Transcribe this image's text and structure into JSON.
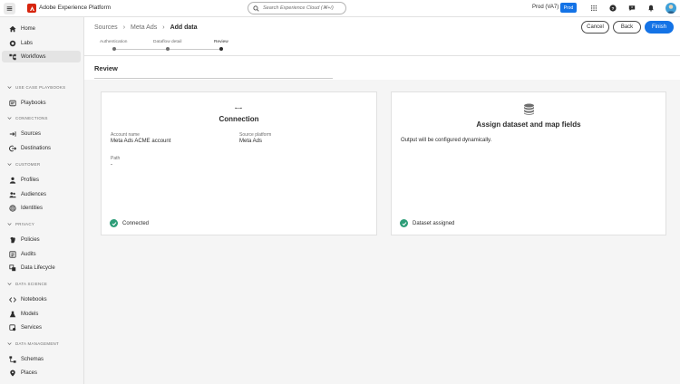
{
  "app": {
    "title": "Adobe Experience Platform"
  },
  "search": {
    "placeholder": "Search Experience Cloud (⌘+/)"
  },
  "header": {
    "org": "Prod (VA7)",
    "env_badge": "Prod"
  },
  "sidebar": {
    "items": [
      {
        "label": "Home",
        "icon": "home-icon"
      },
      {
        "label": "Labs",
        "icon": "labs-icon"
      },
      {
        "label": "Workflows",
        "icon": "workflows-icon",
        "active": true
      }
    ],
    "sections": [
      {
        "title": "USE CASE PLAYBOOKS",
        "items": [
          {
            "label": "Playbooks",
            "icon": "playbooks-icon"
          }
        ]
      },
      {
        "title": "CONNECTIONS",
        "items": [
          {
            "label": "Sources",
            "icon": "sources-icon"
          },
          {
            "label": "Destinations",
            "icon": "destinations-icon"
          }
        ]
      },
      {
        "title": "CUSTOMER",
        "items": [
          {
            "label": "Profiles",
            "icon": "profiles-icon"
          },
          {
            "label": "Audiences",
            "icon": "audiences-icon"
          },
          {
            "label": "Identities",
            "icon": "identities-icon"
          }
        ]
      },
      {
        "title": "PRIVACY",
        "items": [
          {
            "label": "Policies",
            "icon": "policies-icon"
          },
          {
            "label": "Audits",
            "icon": "audits-icon"
          },
          {
            "label": "Data Lifecycle",
            "icon": "data-lifecycle-icon"
          }
        ]
      },
      {
        "title": "DATA SCIENCE",
        "items": [
          {
            "label": "Notebooks",
            "icon": "notebooks-icon"
          },
          {
            "label": "Models",
            "icon": "models-icon"
          },
          {
            "label": "Services",
            "icon": "services-icon"
          }
        ]
      },
      {
        "title": "DATA MANAGEMENT",
        "items": [
          {
            "label": "Schemas",
            "icon": "schemas-icon"
          },
          {
            "label": "Places",
            "icon": "places-icon"
          }
        ]
      }
    ]
  },
  "breadcrumb": [
    "Sources",
    "Meta Ads",
    "Add data"
  ],
  "actions": {
    "cancel": "Cancel",
    "back": "Back",
    "finish": "Finish"
  },
  "steps": [
    {
      "label": "Authentication",
      "state": "done"
    },
    {
      "label": "Dataflow detail",
      "state": "done"
    },
    {
      "label": "Review",
      "state": "current"
    }
  ],
  "review": {
    "heading": "Review",
    "connection": {
      "title": "Connection",
      "account_name_label": "Account name",
      "account_name_value": "Meta Ads ACME account",
      "source_platform_label": "Source platform",
      "source_platform_value": "Meta Ads",
      "path_label": "Path",
      "path_value": "-",
      "status": "Connected"
    },
    "dataset": {
      "title": "Assign dataset and map fields",
      "description": "Output will be configured dynamically.",
      "status": "Dataset assigned"
    }
  },
  "colors": {
    "accent": "#1473e6",
    "brand": "#d7250e",
    "success": "#2d9d78"
  }
}
